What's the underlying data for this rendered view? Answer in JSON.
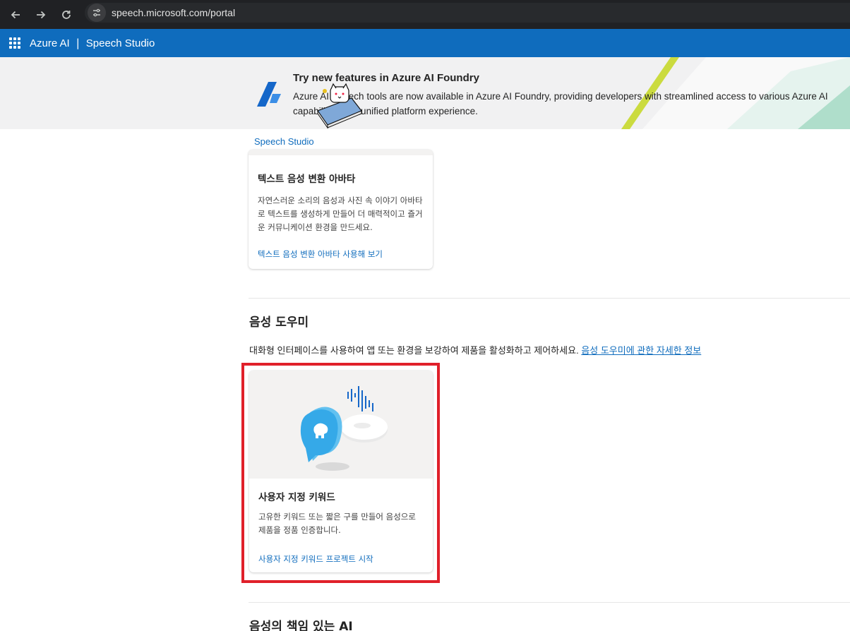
{
  "browser": {
    "url": "speech.microsoft.com/portal",
    "icons": [
      "back-arrow-icon",
      "forward-arrow-icon",
      "reload-icon",
      "site-info-icon"
    ]
  },
  "header": {
    "brand": "Azure AI",
    "separator": "|",
    "product": "Speech Studio",
    "accent_color": "#0f6cbd"
  },
  "banner": {
    "title": "Try new features in Azure AI Foundry",
    "text": "Azure AI Speech tools are now available in Azure AI Foundry, providing developers with streamlined access to various Azure AI capabilities in a unified platform experience."
  },
  "breadcrumb": "Speech Studio",
  "avatar_card": {
    "title": "텍스트 음성 변환 아바타",
    "description": "자연스러운 소리의 음성과 사진 속 이야기 아바타로 텍스트를 생성하게 만들어 더 매력적이고 즐거운 커뮤니케이션 환경을 만드세요.",
    "link": "텍스트 음성 변환 아바타 사용해 보기"
  },
  "voice_assistant": {
    "title": "음성 도우미",
    "description": "대화형 인터페이스를 사용하여 앱 또는 환경을 보강하여 제품을 활성화하고 제어하세요.",
    "learn_more": "음성 도우미에 관한 자세한 정보"
  },
  "keyword_card": {
    "title": "사용자 지정 키워드",
    "description": "고유한 키워드 또는 짧은 구를 만들어 음성으로 제품을 정품 인증합니다.",
    "link": "사용자 지정 키워드 프로젝트 시작",
    "highlight_color": "#e0202a"
  },
  "responsible_ai": {
    "title": "음성의 책임 있는 AI"
  }
}
